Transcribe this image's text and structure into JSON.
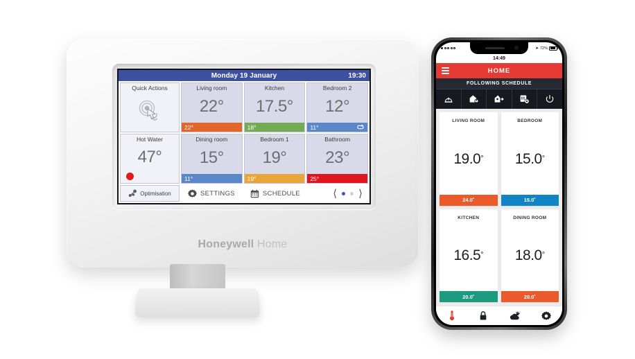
{
  "thermostat": {
    "brand_bold": "Honeywell",
    "brand_light": " Home",
    "header": {
      "date": "Monday 19 January",
      "time": "19:30"
    },
    "quick_actions": {
      "label": "Quick Actions",
      "icon": "hand-tap-icon"
    },
    "hot_water": {
      "label": "Hot Water",
      "temperature": "47°",
      "status_icon": "red-dot-indicator"
    },
    "rooms": [
      {
        "name": "Living room",
        "temperature": "22°",
        "setpoint": "22°",
        "setpoint_color": "#e2652a",
        "repeat": false
      },
      {
        "name": "Kitchen",
        "temperature": "17.5°",
        "setpoint": "18°",
        "setpoint_color": "#76ab55",
        "repeat": false
      },
      {
        "name": "Bedroom 2",
        "temperature": "12°",
        "setpoint": "11°",
        "setpoint_color": "#5a87c8",
        "repeat": true
      },
      {
        "name": "Dining room",
        "temperature": "15°",
        "setpoint": "11°",
        "setpoint_color": "#5a87c8",
        "repeat": false
      },
      {
        "name": "Bedroom 1",
        "temperature": "19°",
        "setpoint": "19°",
        "setpoint_color": "#e8a63a",
        "repeat": false
      },
      {
        "name": "Bathroom",
        "temperature": "23°",
        "setpoint": "25°",
        "setpoint_color": "#dd1622",
        "repeat": false
      }
    ],
    "toolbar": {
      "optimisation_label": "Optimisation",
      "settings_label": "SETTINGS",
      "schedule_label": "SCHEDULE",
      "prev_icon": "chevron-left-icon",
      "next_icon": "chevron-right-icon",
      "page_current": 1,
      "page_count": 2
    },
    "colors": {
      "header": "#3d4f9f",
      "tile": "#d9dae9",
      "accent_dot": "#3d56c4"
    }
  },
  "phone": {
    "status": {
      "time": "14:49",
      "battery": "72%",
      "signal_icon": "signal-dots-icon",
      "battery_icon": "battery-icon",
      "location_icon": "location-arrow-icon"
    },
    "appbar": {
      "title": "HOME",
      "menu_icon": "hamburger-menu-icon"
    },
    "schedule_banner": "FOLLOWING SCHEDULE",
    "modes": [
      {
        "name": "auto-mode-icon"
      },
      {
        "name": "home-mode-icon"
      },
      {
        "name": "away-mode-icon"
      },
      {
        "name": "custom-mode-icon"
      },
      {
        "name": "power-off-icon"
      }
    ],
    "cards": [
      {
        "name": "LIVING ROOM",
        "temperature": "19.0",
        "degree": "°",
        "setpoint": "24.0˚",
        "setpoint_color": "#eb5a2a"
      },
      {
        "name": "BEDROOM",
        "temperature": "15.0",
        "degree": "°",
        "setpoint": "15.0˚",
        "setpoint_color": "#1184c4"
      },
      {
        "name": "KITCHEN",
        "temperature": "16.5",
        "degree": "°",
        "setpoint": "20.0˚",
        "setpoint_color": "#1d9b80"
      },
      {
        "name": "DINING ROOM",
        "temperature": "18.0",
        "degree": "°",
        "setpoint": "20.0˚",
        "setpoint_color": "#eb5a2a"
      }
    ],
    "tabs": [
      {
        "name": "thermometer-icon",
        "color": "#e03a33"
      },
      {
        "name": "lock-icon",
        "color": "#1d1f27"
      },
      {
        "name": "weather-icon",
        "color": "#1d1f27"
      },
      {
        "name": "gear-icon",
        "color": "#1d1f27"
      }
    ],
    "colors": {
      "appbar": "#e63b35",
      "banner": "#272a33",
      "modebar": "#171921"
    }
  }
}
